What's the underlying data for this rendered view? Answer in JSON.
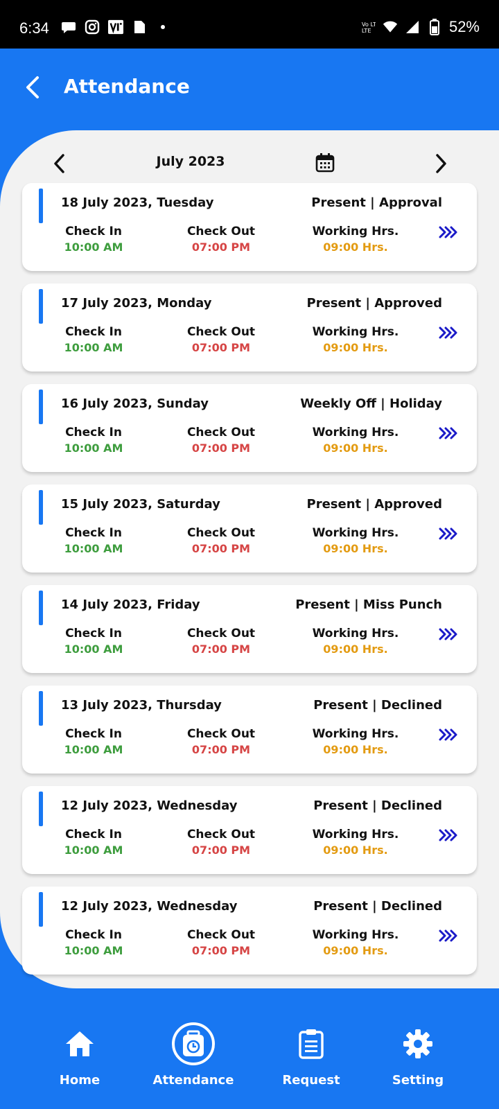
{
  "status_bar": {
    "time": "6:34",
    "battery": "52%",
    "network": "Vo LTE",
    "left_icons": [
      "chat-icon",
      "instagram-icon",
      "vi-icon",
      "sim-icon",
      "dot-icon"
    ],
    "right_icons": [
      "volte-icon",
      "wifi-icon",
      "signal-icon",
      "battery-icon"
    ]
  },
  "app_bar": {
    "title": "Attendance",
    "back_icon": "chevron-left-icon"
  },
  "month_nav": {
    "label": "July 2023"
  },
  "columns": {
    "check_in": "Check In",
    "check_out": "Check Out",
    "working": "Working Hrs."
  },
  "records": [
    {
      "date": "18 July 2023, Tuesday",
      "status": "Present | Approval",
      "check_in": "10:00 AM",
      "check_out": "07:00 PM",
      "hours": "09:00 Hrs."
    },
    {
      "date": "17 July 2023, Monday",
      "status": "Present | Approved",
      "check_in": "10:00 AM",
      "check_out": "07:00 PM",
      "hours": "09:00 Hrs."
    },
    {
      "date": "16 July 2023, Sunday",
      "status": "Weekly Off | Holiday",
      "check_in": "10:00 AM",
      "check_out": "07:00 PM",
      "hours": "09:00 Hrs."
    },
    {
      "date": "15 July 2023, Saturday",
      "status": "Present | Approved",
      "check_in": "10:00 AM",
      "check_out": "07:00 PM",
      "hours": "09:00 Hrs."
    },
    {
      "date": "14 July 2023, Friday",
      "status": "Present | Miss Punch",
      "check_in": "10:00 AM",
      "check_out": "07:00 PM",
      "hours": "09:00 Hrs."
    },
    {
      "date": "13 July 2023, Thursday",
      "status": "Present | Declined",
      "check_in": "10:00 AM",
      "check_out": "07:00 PM",
      "hours": "09:00 Hrs."
    },
    {
      "date": "12 July 2023, Wednesday",
      "status": "Present | Declined",
      "check_in": "10:00 AM",
      "check_out": "07:00 PM",
      "hours": "09:00 Hrs."
    },
    {
      "date": "12 July 2023, Wednesday",
      "status": "Present | Declined",
      "check_in": "10:00 AM",
      "check_out": "07:00 PM",
      "hours": "09:00 Hrs."
    }
  ],
  "bottom_nav": {
    "home": "Home",
    "attendance": "Attendance",
    "request": "Request",
    "setting": "Setting"
  },
  "colors": {
    "primary": "#1877f2",
    "check_in": "#3e9d3e",
    "check_out": "#d64545",
    "hours": "#e39b12",
    "arrow": "#1a1ac8"
  }
}
